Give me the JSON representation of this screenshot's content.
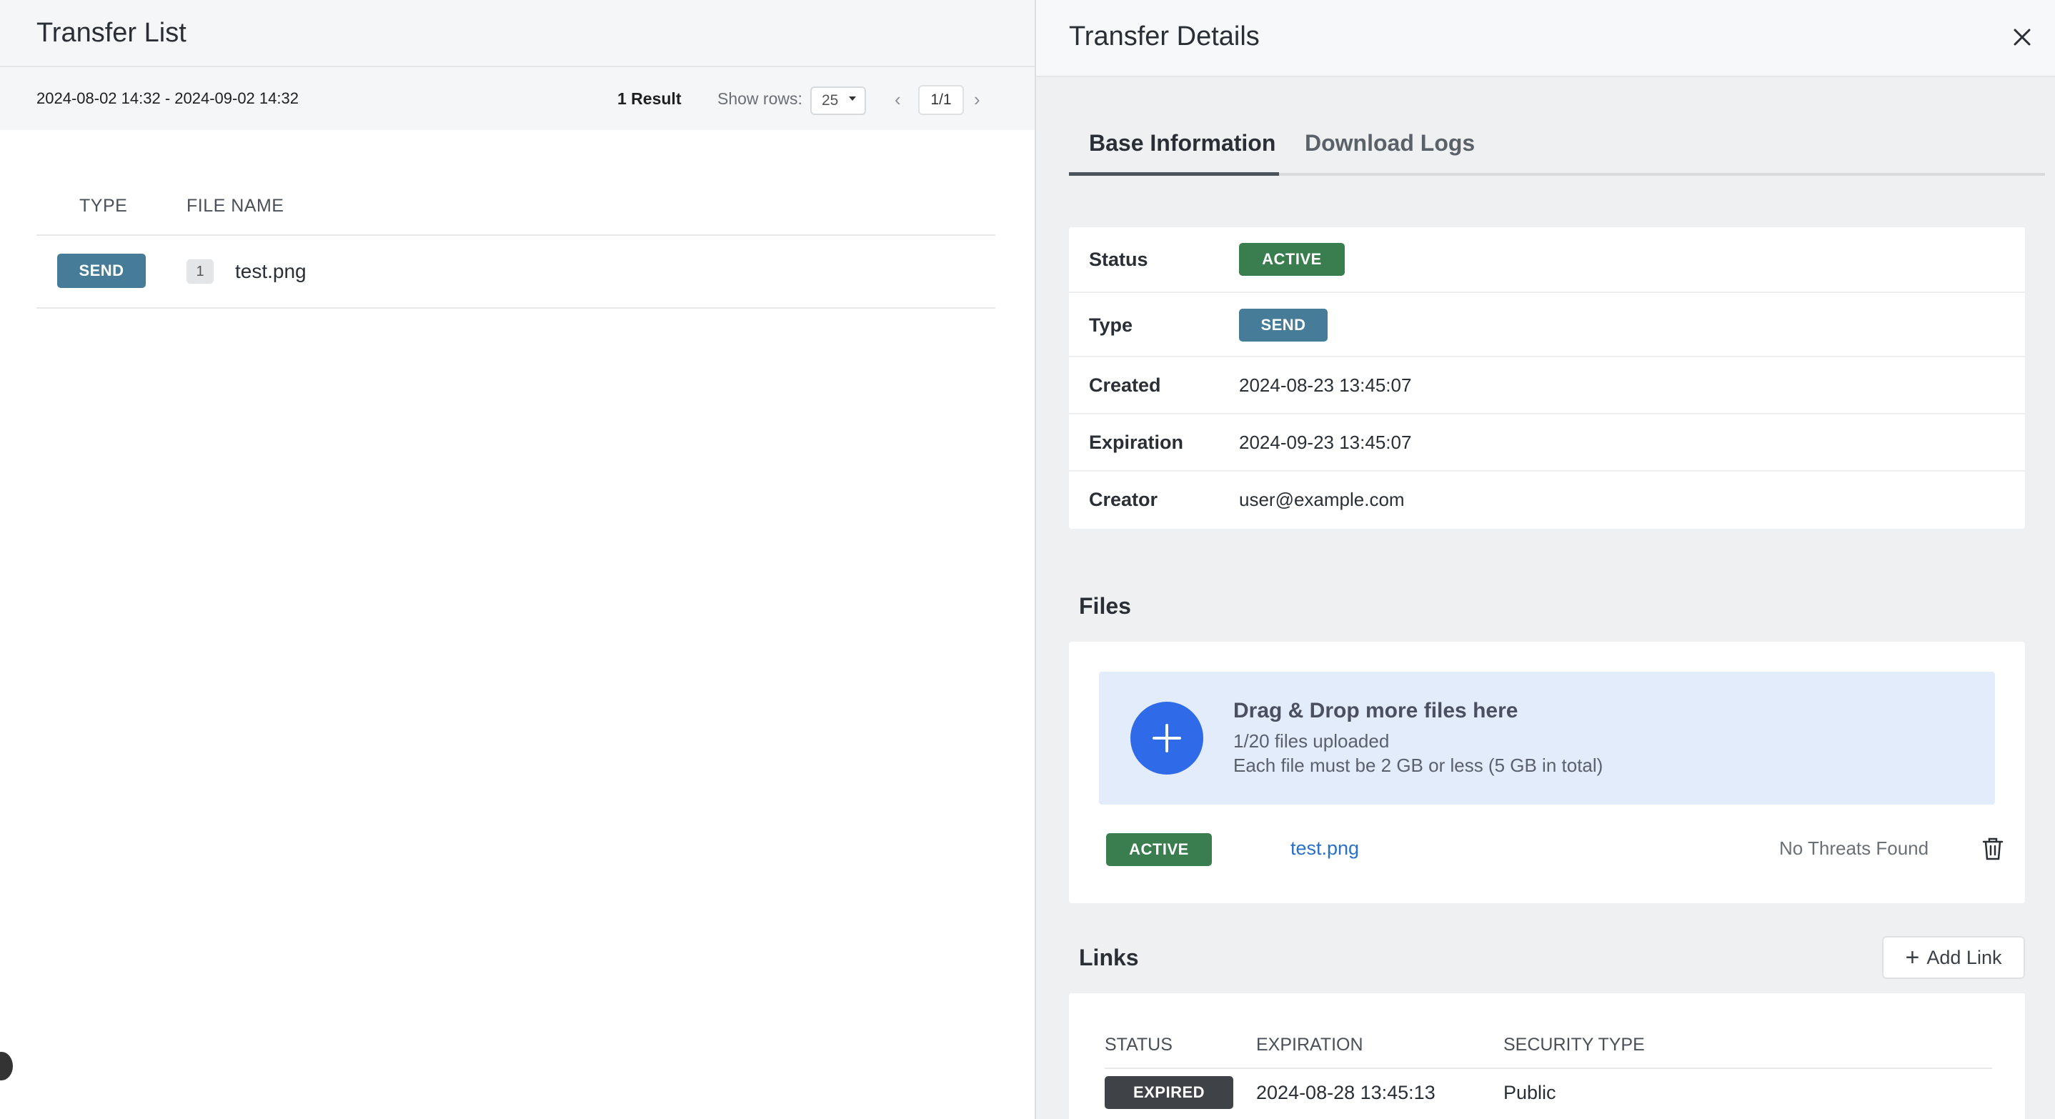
{
  "left": {
    "title": "Transfer List",
    "date_range": "2024-08-02 14:32 - 2024-09-02 14:32",
    "result_count": "1 Result",
    "show_rows_label": "Show rows:",
    "rows_per_page": "25",
    "page_indicator": "1/1",
    "table": {
      "headers": {
        "type": "TYPE",
        "file_name": "FILE NAME"
      },
      "rows": [
        {
          "type": "SEND",
          "count": "1",
          "file_name": "test.png"
        }
      ]
    }
  },
  "details": {
    "title": "Transfer Details",
    "tabs": [
      {
        "label": "Base Information",
        "active": true
      },
      {
        "label": "Download Logs",
        "active": false
      }
    ],
    "base_info": {
      "status_label": "Status",
      "status_value": "ACTIVE",
      "type_label": "Type",
      "type_value": "SEND",
      "created_label": "Created",
      "created_value": "2024-08-23 13:45:07",
      "expiration_label": "Expiration",
      "expiration_value": "2024-09-23 13:45:07",
      "creator_label": "Creator",
      "creator_value": "user@example.com"
    },
    "files": {
      "section_title": "Files",
      "drop_title": "Drag & Drop more files here",
      "drop_count": "1/20 files uploaded",
      "drop_limit": "Each file must be 2 GB or less (5 GB in total)",
      "items": [
        {
          "status": "ACTIVE",
          "name": "test.png",
          "scan": "No Threats Found"
        }
      ]
    },
    "links": {
      "section_title": "Links",
      "add_label": "Add Link",
      "headers": {
        "status": "STATUS",
        "expiration": "EXPIRATION",
        "security": "SECURITY TYPE"
      },
      "rows": [
        {
          "status": "EXPIRED",
          "expiration": "2024-08-28 13:45:13",
          "security": "Public"
        }
      ]
    }
  },
  "colors": {
    "send_badge": "#467c97",
    "active_badge": "#3a7d4e",
    "expired_badge": "#3f4246",
    "primary_blue": "#2f6ae8",
    "link_blue": "#2a6fc9"
  }
}
